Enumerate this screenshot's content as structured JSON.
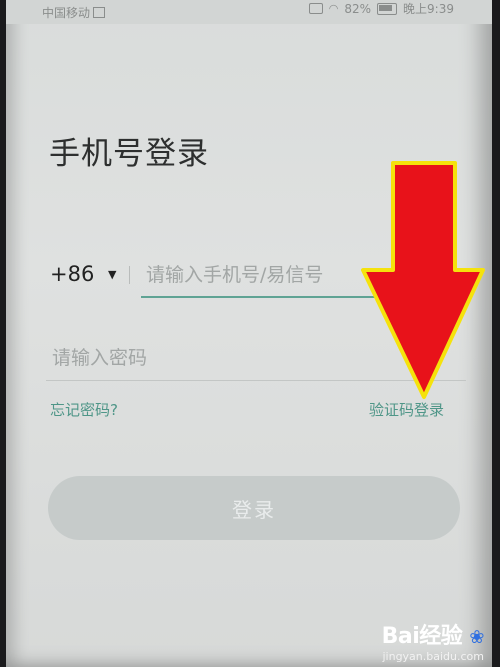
{
  "status_bar": {
    "carrier": "中国移动",
    "battery": "82%",
    "time": "晚上9:39"
  },
  "icons": {
    "signal": "signal-icon",
    "wifi": "wifi-icon",
    "battery": "battery-icon",
    "sim": "sim-icon",
    "caret": "caret-down-icon"
  },
  "page": {
    "title": "手机号登录"
  },
  "phone_field": {
    "country_code": "+86",
    "caret": "▼",
    "placeholder": "请输入手机号/易信号"
  },
  "password_field": {
    "placeholder": "请输入密码"
  },
  "links": {
    "forgot_password": "忘记密码?",
    "code_login": "验证码登录"
  },
  "login_button": {
    "label": "登录"
  },
  "annotation": {
    "arrow_color": "#e8121a",
    "arrow_border": "#f5e20c"
  },
  "watermark": {
    "brand": "Bai经验",
    "paw": "❀",
    "site": "jingyan.baidu.com"
  },
  "colors": {
    "accent": "#4f9688",
    "button_disabled": "#c6cbca",
    "screen_bg": "#dcdedd"
  }
}
